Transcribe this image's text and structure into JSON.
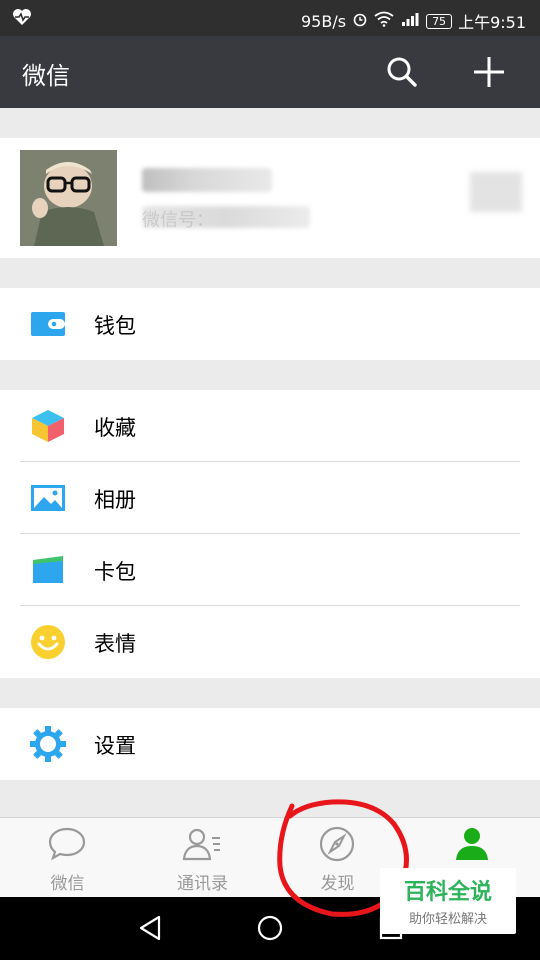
{
  "status_bar": {
    "speed": "95B/s",
    "battery": "75",
    "time": "上午9:51"
  },
  "header": {
    "title": "微信"
  },
  "profile": {
    "name": " ",
    "wxid": "微信号："
  },
  "menu": {
    "wallet": "钱包",
    "favorites": "收藏",
    "album": "相册",
    "cards": "卡包",
    "stickers": "表情",
    "settings": "设置"
  },
  "tabs": [
    {
      "label": "微信",
      "icon": "chat-bubble-icon"
    },
    {
      "label": "通讯录",
      "icon": "contacts-icon"
    },
    {
      "label": "发现",
      "icon": "compass-icon"
    },
    {
      "label": "",
      "icon": "person-icon",
      "active": true
    }
  ],
  "watermark": {
    "title": "百科全说",
    "subtitle": "助你轻松解决"
  },
  "colors": {
    "header_bg": "#393a3f",
    "accent_green": "#1aad19",
    "annotation": "#e8161b"
  }
}
